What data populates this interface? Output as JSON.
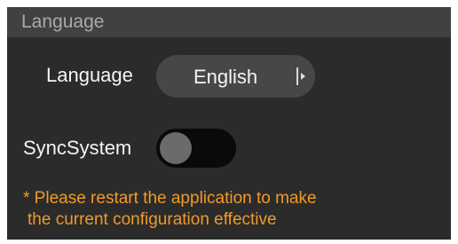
{
  "section": {
    "title": "Language"
  },
  "language": {
    "label": "Language",
    "value": "English"
  },
  "sync": {
    "label": "SyncSystem",
    "enabled": false
  },
  "note": {
    "line1": "* Please restart the application to make",
    "line2": "the current configuration effective"
  },
  "colors": {
    "panel": "#2b2b2b",
    "header": "#414141",
    "note": "#f09a2a",
    "toggle_track": "#0a0a0a"
  }
}
